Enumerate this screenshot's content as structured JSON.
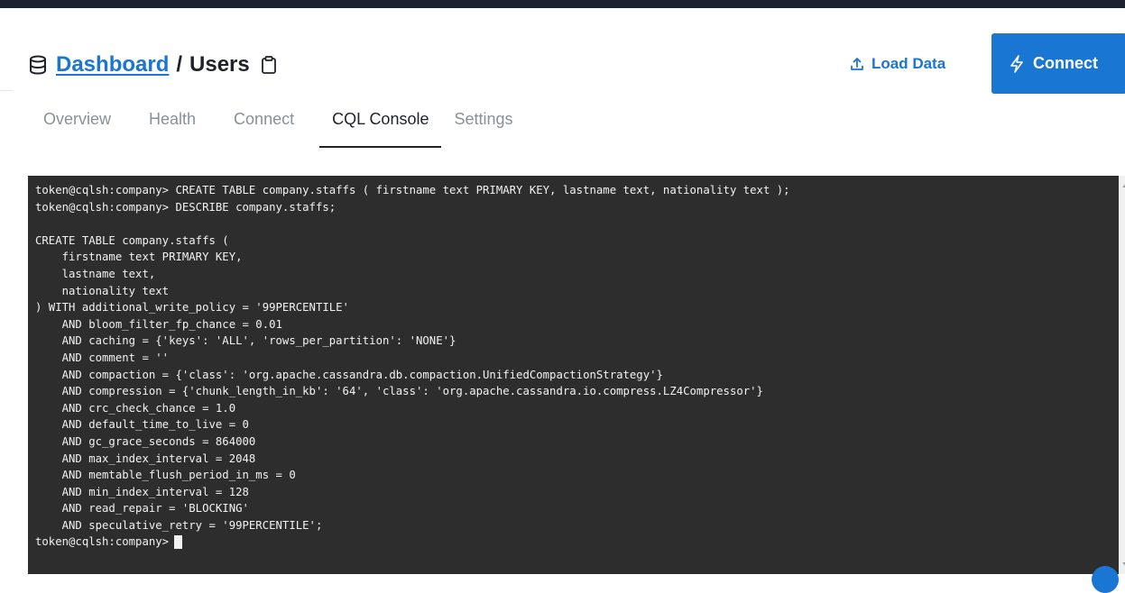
{
  "breadcrumb": {
    "link": "Dashboard",
    "separator": "/",
    "current": "Users"
  },
  "actions": {
    "load_data": "Load Data",
    "connect": "Connect"
  },
  "tabs": [
    {
      "label": "Overview",
      "active": false
    },
    {
      "label": "Health",
      "active": false
    },
    {
      "label": "Connect",
      "active": false
    },
    {
      "label": "CQL Console",
      "active": true
    },
    {
      "label": "Settings",
      "active": false
    }
  ],
  "console": {
    "output": "token@cqlsh:company> CREATE TABLE company.staffs ( firstname text PRIMARY KEY, lastname text, nationality text );\ntoken@cqlsh:company> DESCRIBE company.staffs;\n\nCREATE TABLE company.staffs (\n    firstname text PRIMARY KEY,\n    lastname text,\n    nationality text\n) WITH additional_write_policy = '99PERCENTILE'\n    AND bloom_filter_fp_chance = 0.01\n    AND caching = {'keys': 'ALL', 'rows_per_partition': 'NONE'}\n    AND comment = ''\n    AND compaction = {'class': 'org.apache.cassandra.db.compaction.UnifiedCompactionStrategy'}\n    AND compression = {'chunk_length_in_kb': '64', 'class': 'org.apache.cassandra.io.compress.LZ4Compressor'}\n    AND crc_check_chance = 1.0\n    AND default_time_to_live = 0\n    AND gc_grace_seconds = 864000\n    AND max_index_interval = 2048\n    AND memtable_flush_period_in_ms = 0\n    AND min_index_interval = 128\n    AND read_repair = 'BLOCKING'\n    AND speculative_retry = '99PERCENTILE';\n",
    "prompt": "token@cqlsh:company>"
  },
  "colors": {
    "accent": "#1976d2",
    "console_bg": "#2d2d2d",
    "top_bar": "#1c2230"
  }
}
